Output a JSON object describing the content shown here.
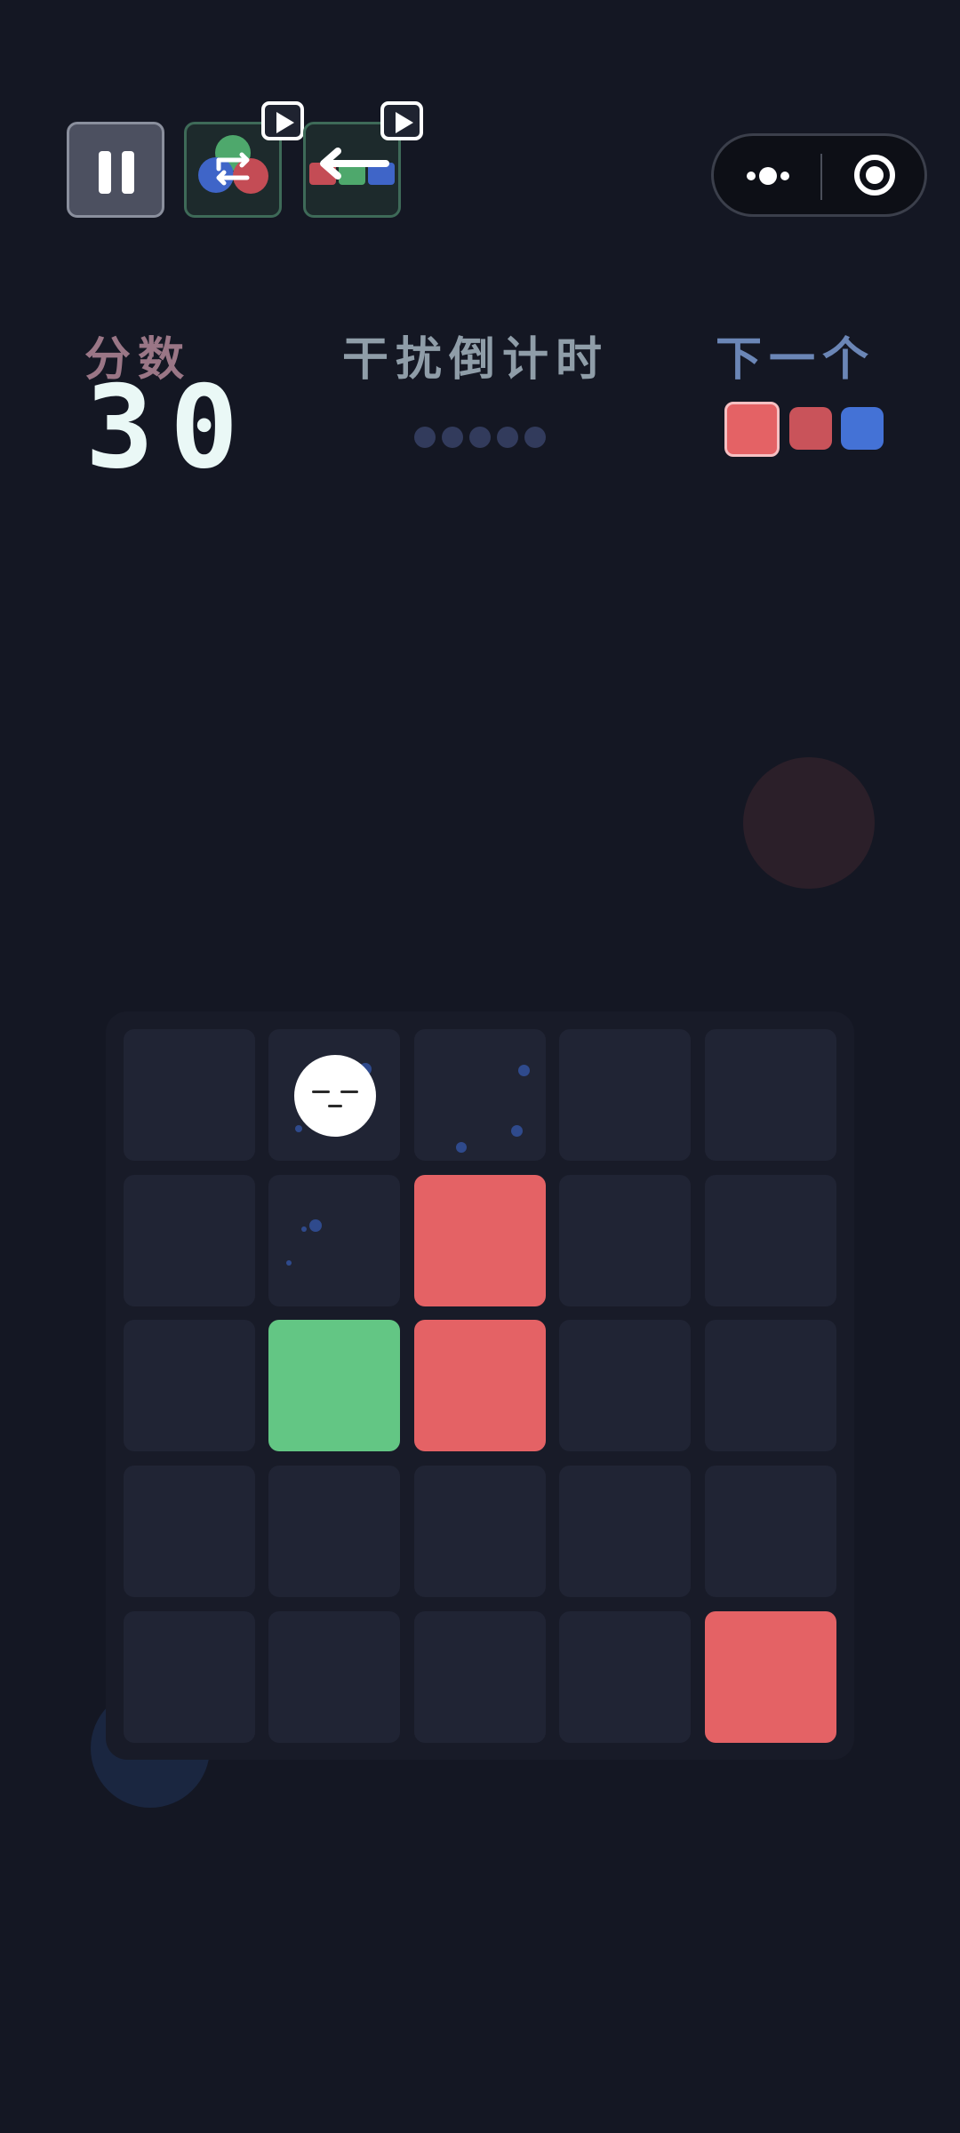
{
  "hud": {
    "score_label": "分数",
    "score_value": "30",
    "countdown_label": "干扰倒计时",
    "countdown_dots": 5,
    "next_label": "下一个",
    "next_colors": [
      "red",
      "red",
      "blue"
    ]
  },
  "toolbar": {
    "buttons": [
      "pause-icon",
      "shuffle-powerup-icon",
      "shift-row-powerup-icon"
    ],
    "ad_badge_icon": "play-icon"
  },
  "capsule": {
    "more_icon": "more-dots-icon",
    "close_icon": "target-close-icon"
  },
  "board": {
    "rows": 5,
    "cols": 5,
    "grid": [
      [
        "",
        "face",
        "",
        "",
        ""
      ],
      [
        "",
        "",
        "red",
        "",
        ""
      ],
      [
        "",
        "green",
        "red",
        "",
        ""
      ],
      [
        "",
        "",
        "",
        "",
        ""
      ],
      [
        "",
        "",
        "",
        "",
        "red"
      ]
    ]
  },
  "colors": {
    "background": "#141723",
    "red": "#e46265",
    "red_dark": "#c9535a",
    "green": "#63c684",
    "blue": "#4472d6",
    "score_label": "#9a7686",
    "countdown_label": "#8f9da8",
    "next_label": "#6b86b6"
  }
}
